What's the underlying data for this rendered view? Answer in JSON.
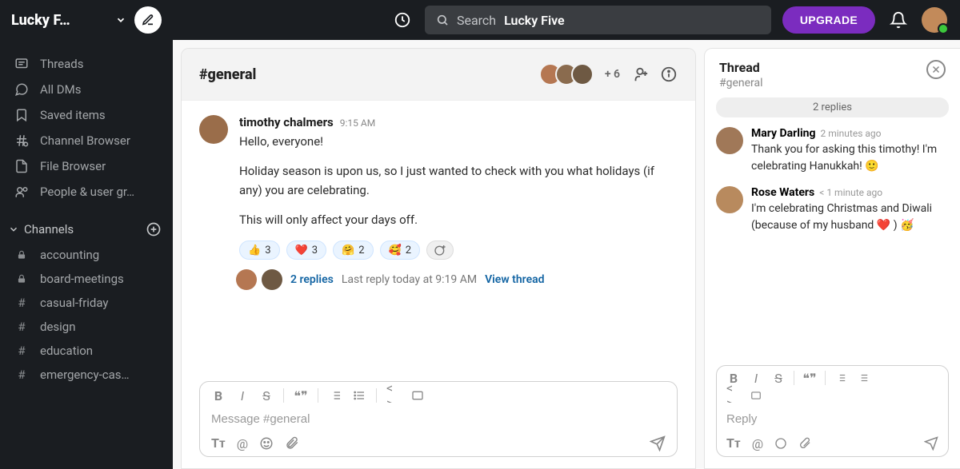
{
  "workspace": {
    "name": "Lucky F…"
  },
  "topbar": {
    "search_prefix": "Search",
    "search_workspace": "Lucky Five",
    "upgrade": "UPGRADE"
  },
  "sidebar_nav": [
    {
      "label": "Threads",
      "icon": "threads-icon"
    },
    {
      "label": "All DMs",
      "icon": "dms-icon"
    },
    {
      "label": "Saved items",
      "icon": "bookmark-icon"
    },
    {
      "label": "Channel Browser",
      "icon": "channel-browser-icon"
    },
    {
      "label": "File Browser",
      "icon": "file-browser-icon"
    },
    {
      "label": "People & user gr…",
      "icon": "people-icon"
    }
  ],
  "channel_section": {
    "title": "Channels"
  },
  "channels": [
    {
      "label": "accounting",
      "locked": true
    },
    {
      "label": "board-meetings",
      "locked": true
    },
    {
      "label": "casual-friday",
      "locked": false
    },
    {
      "label": "design",
      "locked": false
    },
    {
      "label": "education",
      "locked": false
    },
    {
      "label": "emergency-cas…",
      "locked": false
    }
  ],
  "channel_header": {
    "title": "#general",
    "extra_members": "+ 6"
  },
  "message": {
    "user": "timothy chalmers",
    "time": "9:15 AM",
    "p1": "Hello, everyone!",
    "p2": "Holiday season is upon us, so I just wanted to check with you what holidays (if any) you are celebrating.",
    "p3": "This will only affect your days off.",
    "reactions": [
      {
        "emoji": "👍",
        "count": "3"
      },
      {
        "emoji": "❤️",
        "count": "3"
      },
      {
        "emoji": "🤗",
        "count": "2"
      },
      {
        "emoji": "🥰",
        "count": "2"
      }
    ],
    "thread_replies": "2 replies",
    "last_reply": "Last reply today at 9:19 AM",
    "view_thread": "View thread"
  },
  "composer": {
    "placeholder": "Message #general"
  },
  "thread": {
    "title": "Thread",
    "subtitle": "#general",
    "badge": "2 replies",
    "messages": [
      {
        "user": "Mary Darling",
        "time": "2 minutes ago",
        "text": "Thank you for asking this timothy! I'm celebrating Hanukkah! 🙂"
      },
      {
        "user": "Rose Waters",
        "time": "< 1 minute ago",
        "text": "I'm celebrating Christmas and Diwali (because of my husband ❤️ ) 🥳"
      }
    ],
    "reply_placeholder": "Reply"
  }
}
